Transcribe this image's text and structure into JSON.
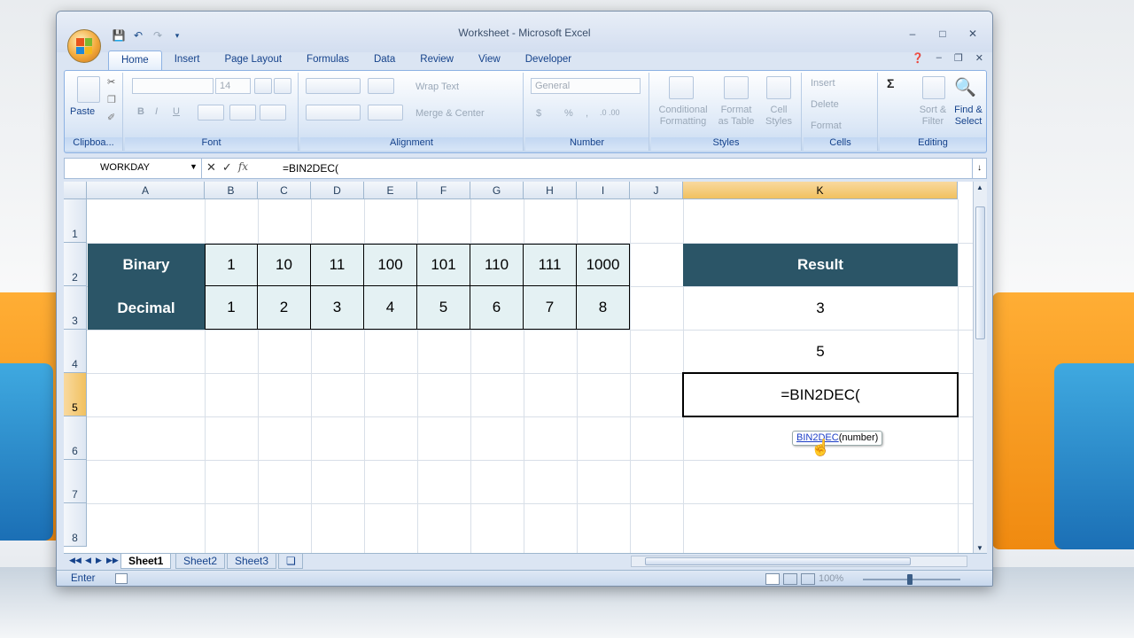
{
  "app": {
    "title": "Worksheet - Microsoft Excel",
    "win_minimize": "–",
    "win_maximize": "□",
    "win_close": "✕"
  },
  "tabs": [
    "Home",
    "Insert",
    "Page Layout",
    "Formulas",
    "Data",
    "Review",
    "View",
    "Developer"
  ],
  "ribbon": {
    "clipboard": {
      "paste": "Paste",
      "label": "Clipboa..."
    },
    "font": {
      "size": "14",
      "bold": "B",
      "italic": "I",
      "underline": "U",
      "label": "Font"
    },
    "alignment": {
      "wrap_text": "Wrap Text",
      "merge_center": "Merge & Center",
      "label": "Alignment"
    },
    "number": {
      "format": "General",
      "currency": "$",
      "percent": "%",
      "comma": ",",
      "inc_dec": ".0 .00",
      "label": "Number"
    },
    "styles": {
      "conditional": "Conditional Formatting",
      "format_table": "Format as Table",
      "cell_styles": "Cell Styles",
      "label": "Styles"
    },
    "cells": {
      "insert": "Insert",
      "delete": "Delete",
      "format": "Format",
      "label": "Cells"
    },
    "editing": {
      "sort_filter": "Sort & Filter",
      "find_select": "Find & Select",
      "label": "Editing"
    }
  },
  "formula_bar": {
    "name_box": "WORKDAY",
    "formula": "=BIN2DEC("
  },
  "columns": [
    "A",
    "B",
    "C",
    "D",
    "E",
    "F",
    "G",
    "H",
    "I",
    "J",
    "K"
  ],
  "rows": [
    "1",
    "2",
    "3",
    "4",
    "5",
    "6",
    "7",
    "8"
  ],
  "table": {
    "binary_label": "Binary",
    "decimal_label": "Decimal",
    "binary": [
      "1",
      "10",
      "11",
      "100",
      "101",
      "110",
      "111",
      "1000"
    ],
    "decimal": [
      "1",
      "2",
      "3",
      "4",
      "5",
      "6",
      "7",
      "8"
    ]
  },
  "result": {
    "header": "Result",
    "values": [
      "3",
      "5"
    ],
    "editing": "=BIN2DEC("
  },
  "tooltip": {
    "func": "BIN2DEC",
    "args": "(number)"
  },
  "sheets": [
    "Sheet1",
    "Sheet2",
    "Sheet3"
  ],
  "status": {
    "mode": "Enter",
    "zoom": "100%"
  }
}
